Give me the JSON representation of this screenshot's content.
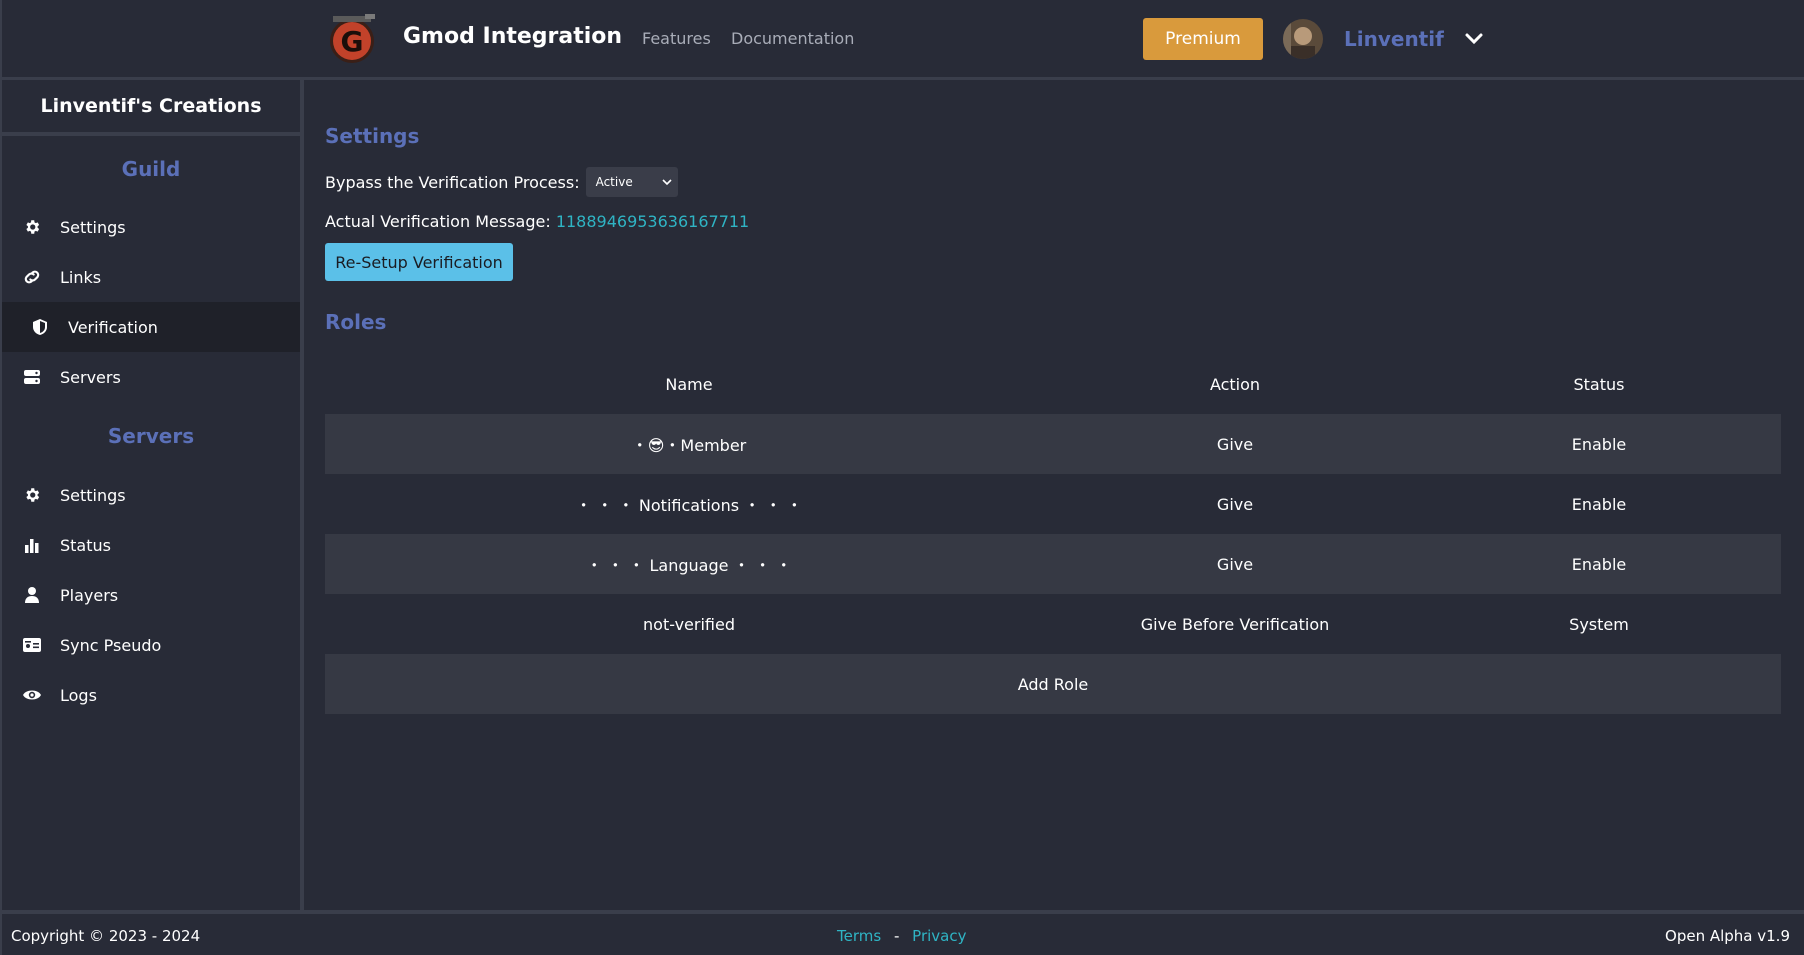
{
  "header": {
    "brand": "Gmod Integration",
    "nav": [
      "Features",
      "Documentation"
    ],
    "premium_label": "Premium",
    "username": "Linventif",
    "logo_letter": "G"
  },
  "sidebar": {
    "title": "Linventif's Creations",
    "sections": [
      {
        "title": "Guild",
        "items": [
          {
            "label": "Settings",
            "icon": "gear-icon"
          },
          {
            "label": "Links",
            "icon": "link-icon"
          },
          {
            "label": "Verification",
            "icon": "shield-icon",
            "active": true
          },
          {
            "label": "Servers",
            "icon": "server-icon"
          }
        ]
      },
      {
        "title": "Servers",
        "items": [
          {
            "label": "Settings",
            "icon": "gear-icon"
          },
          {
            "label": "Status",
            "icon": "bar-chart-icon"
          },
          {
            "label": "Players",
            "icon": "user-icon"
          },
          {
            "label": "Sync Pseudo",
            "icon": "id-card-icon"
          },
          {
            "label": "Logs",
            "icon": "eye-icon"
          }
        ]
      }
    ]
  },
  "main": {
    "settings_title": "Settings",
    "bypass_label": "Bypass the Verification Process:",
    "bypass_value": "Active",
    "message_label": "Actual Verification Message:",
    "message_id": "1188946953636167711",
    "resetup_label": "Re-Setup Verification",
    "roles_title": "Roles",
    "roles_headers": [
      "Name",
      "Action",
      "Status"
    ],
    "roles": [
      {
        "name": "・😎・Member",
        "action": "Give",
        "status": "Enable"
      },
      {
        "name": "・ ・ ・ Notifications ・ ・ ・",
        "action": "Give",
        "status": "Enable"
      },
      {
        "name": "・ ・ ・ Language ・ ・ ・",
        "action": "Give",
        "status": "Enable"
      },
      {
        "name": "not-verified",
        "action": "Give Before Verification",
        "status": "System"
      }
    ],
    "add_role_label": "Add Role"
  },
  "footer": {
    "copyright": "Copyright © 2023 - 2024",
    "terms": "Terms",
    "separator": "-",
    "privacy": "Privacy",
    "version": "Open Alpha v1.9"
  },
  "colors": {
    "background": "#282b37",
    "accent_blue": "#5b70b8",
    "premium": "#d99a3c",
    "button_cyan": "#5bc0e8",
    "link_teal": "#2fb4c4"
  }
}
